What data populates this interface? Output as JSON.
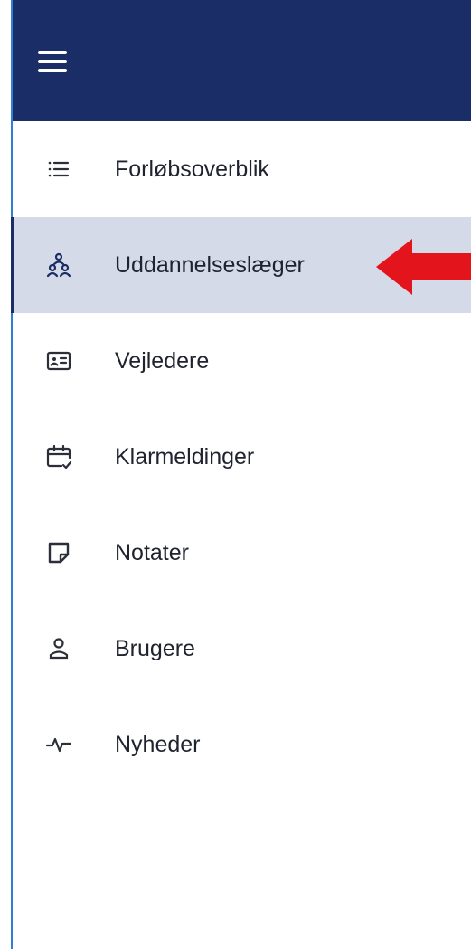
{
  "header": {
    "menu_icon": "hamburger-menu-icon",
    "background_color": "#1b2d66"
  },
  "nav": {
    "active_index": 1,
    "active_background": "#d4dae8",
    "items": [
      {
        "label": "Forløbsoverblik",
        "icon": "list-icon"
      },
      {
        "label": "Uddannelseslæger",
        "icon": "people-group-icon"
      },
      {
        "label": "Vejledere",
        "icon": "id-card-icon"
      },
      {
        "label": "Klarmeldinger",
        "icon": "calendar-check-icon"
      },
      {
        "label": "Notater",
        "icon": "note-icon"
      },
      {
        "label": "Brugere",
        "icon": "person-icon"
      },
      {
        "label": "Nyheder",
        "icon": "activity-pulse-icon"
      }
    ]
  },
  "annotation": {
    "arrow_icon": "red-arrow-icon",
    "arrow_color": "#e3141b"
  }
}
